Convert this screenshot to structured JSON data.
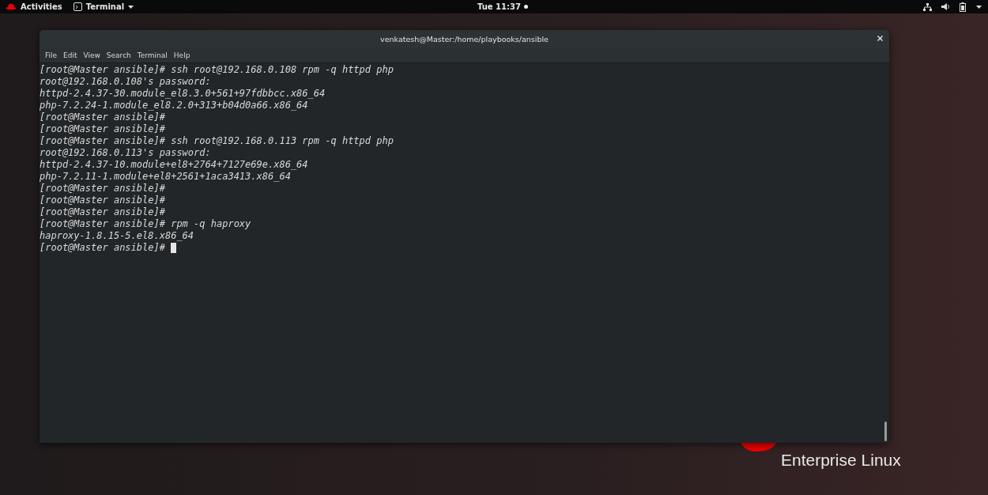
{
  "top_bar": {
    "activities": "Activities",
    "app_menu": "Terminal",
    "clock": "Tue 11:37"
  },
  "desktop": {
    "logo_text": "Enterprise Linux"
  },
  "window": {
    "title": "venkatesh@Master:/home/playbooks/ansible",
    "menu": [
      "File",
      "Edit",
      "View",
      "Search",
      "Terminal",
      "Help"
    ],
    "terminal": {
      "cursor": true,
      "lines": [
        "[root@Master ansible]# ssh root@192.168.0.108 rpm -q httpd php",
        "root@192.168.0.108's password:",
        "httpd-2.4.37-30.module_el8.3.0+561+97fdbbcc.x86_64",
        "php-7.2.24-1.module_el8.2.0+313+b04d0a66.x86_64",
        "[root@Master ansible]#",
        "[root@Master ansible]#",
        "[root@Master ansible]# ssh root@192.168.0.113 rpm -q httpd php",
        "root@192.168.0.113's password:",
        "httpd-2.4.37-10.module+el8+2764+7127e69e.x86_64",
        "php-7.2.11-1.module+el8+2561+1aca3413.x86_64",
        "[root@Master ansible]#",
        "[root@Master ansible]#",
        "[root@Master ansible]#",
        "[root@Master ansible]# rpm -q haproxy",
        "haproxy-1.8.15-5.el8.x86_64",
        "[root@Master ansible]# "
      ]
    }
  }
}
